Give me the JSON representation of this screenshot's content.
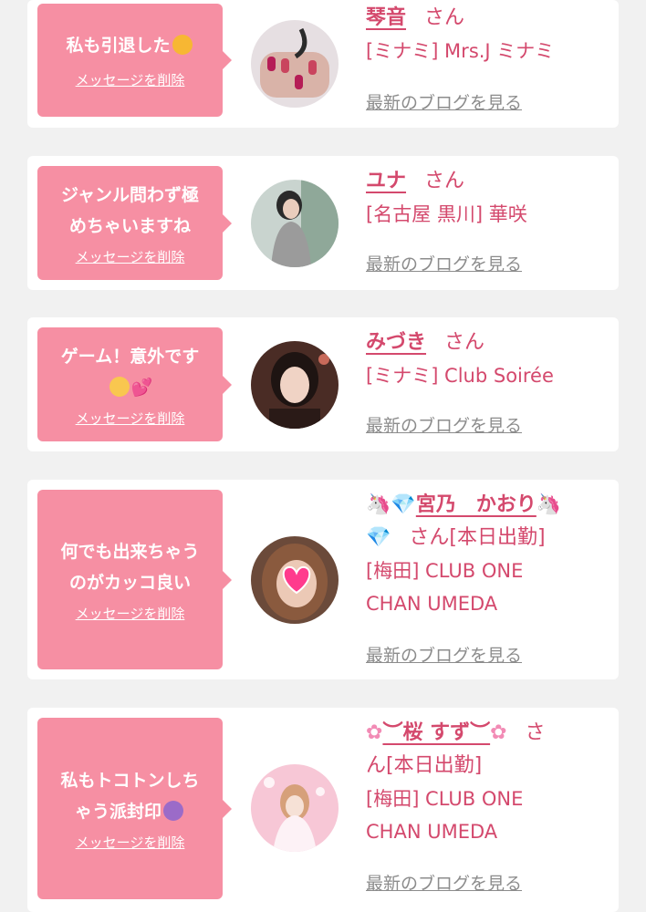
{
  "messages": [
    {
      "bubble_line1": "私も引退した",
      "bubble_line2": "",
      "bubble_emoji": "smiling-face-with-hearts",
      "delete_label": "メッセージを削除",
      "name": "琴音",
      "honorific": "さん",
      "shop_line1": "[ミナミ] Mrs.J ミナミ",
      "shop_line2": "",
      "blog_link": "最新のブログを見る"
    },
    {
      "bubble_line1": "ジャンル問わず極",
      "bubble_line2": "めちゃいますね",
      "delete_label": "メッセージを削除",
      "name": "ユナ",
      "honorific": "さん",
      "shop_line1": "[名古屋 黒川] 華咲",
      "shop_line2": "",
      "blog_link": "最新のブログを見る"
    },
    {
      "bubble_line1": "ゲーム！意外です",
      "bubble_line2": "",
      "bubble_emoji": "pleading-face, two-hearts",
      "delete_label": "メッセージを削除",
      "name": "みづき",
      "honorific": "さん",
      "shop_line1": "[ミナミ] Club Soirée",
      "shop_line2": "",
      "blog_link": "最新のブログを見る"
    },
    {
      "bubble_line1": "何でも出来ちゃう",
      "bubble_line2": "のがカッコ良い",
      "delete_label": "メッセージを削除",
      "name_emoji_before": "unicorn, gem",
      "name": "宮乃　かおり",
      "name_emoji_after": "unicorn, gem",
      "honorific": "さん[本日出勤]",
      "shop_line1": "[梅田] CLUB ONE",
      "shop_line2": "CHAN UMEDA",
      "blog_link": "最新のブログを見る"
    },
    {
      "bubble_line1": "私もトコトンしち",
      "bubble_line2": "ゃう派封印",
      "bubble_emoji": "person-gesturing-no",
      "delete_label": "メッセージを削除",
      "name_emoji_before": "cherry-blossom",
      "name": "︶桜 すず︶",
      "name_emoji_after": "cherry-blossom",
      "honorific_line1": "さ",
      "honorific_line2": "ん[本日出勤]",
      "shop_line1": "[梅田] CLUB ONE",
      "shop_line2": "CHAN UMEDA",
      "blog_link": "最新のブログを見る"
    }
  ],
  "colors": {
    "bubble": "#f68fa3",
    "accent": "#d4496d",
    "link": "#8c8c8c",
    "bg": "#f1f1f1"
  }
}
